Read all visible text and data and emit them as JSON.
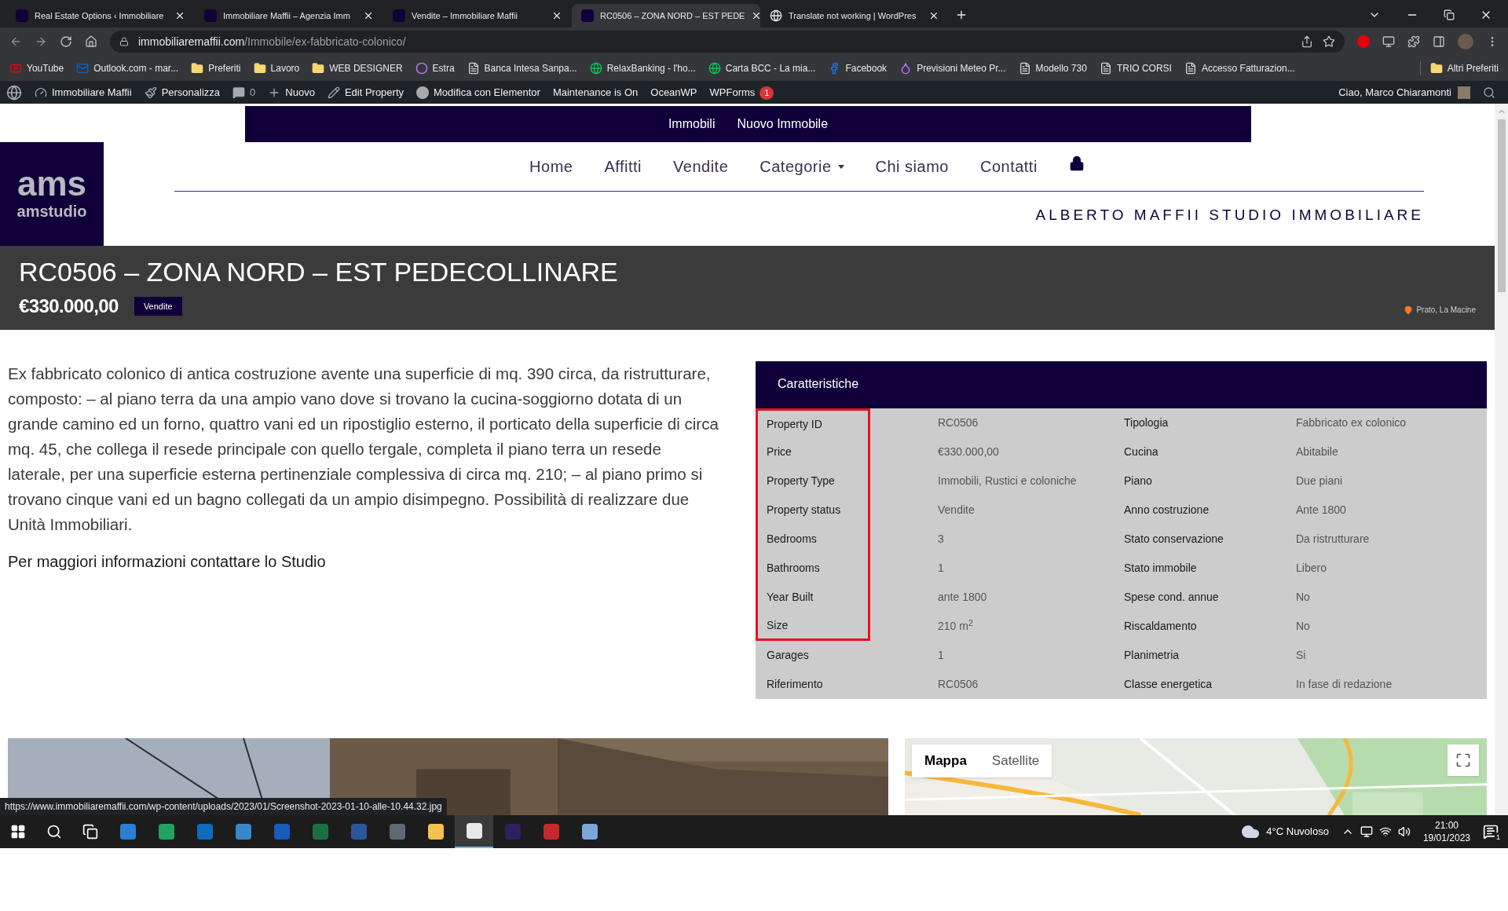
{
  "browser": {
    "tabs": [
      {
        "title": "Real Estate Options ‹ Immobiliare",
        "selected": false,
        "kind": "ams"
      },
      {
        "title": "Immobiliare Maffii – Agenzia Imm",
        "selected": false,
        "kind": "ams"
      },
      {
        "title": "Vendite – Immobiliare Maffii",
        "selected": false,
        "kind": "ams"
      },
      {
        "title": "RC0506 – ZONA NORD – EST PEDE",
        "selected": true,
        "kind": "ams"
      },
      {
        "title": "Translate not working | WordPres",
        "selected": false,
        "kind": "wp"
      }
    ],
    "url_host": "immobiliaremaffii.com",
    "url_path": "/Immobile/ex-fabbricato-colonico/",
    "bookmarks": [
      {
        "label": "YouTube",
        "kind": "youtube"
      },
      {
        "label": "Outlook.com - mar...",
        "kind": "outlook"
      },
      {
        "label": "Preferiti",
        "kind": "folder"
      },
      {
        "label": "Lavoro",
        "kind": "folder"
      },
      {
        "label": "WEB DESIGNER",
        "kind": "folder"
      },
      {
        "label": "Estra",
        "kind": "ring"
      },
      {
        "label": "Banca Intesa Sanpa...",
        "kind": "bank"
      },
      {
        "label": "RelaxBanking - l'ho...",
        "kind": "globe"
      },
      {
        "label": "Carta BCC - La mia...",
        "kind": "globe"
      },
      {
        "label": "Facebook",
        "kind": "facebook"
      },
      {
        "label": "Previsioni Meteo Pr...",
        "kind": "drop"
      },
      {
        "label": "Modello 730",
        "kind": "doc"
      },
      {
        "label": "TRIO CORSI",
        "kind": "trio"
      },
      {
        "label": "Accesso Fatturazion...",
        "kind": "doc"
      }
    ],
    "other_bookmarks": "Altri Preferiti"
  },
  "admin_bar": {
    "site": "Immobiliare Maffii",
    "customize": "Personalizza",
    "comments": "0",
    "new": "Nuovo",
    "edit": "Edit Property",
    "elementor": "Modifica con Elementor",
    "maintenance": "Maintenance is On",
    "theme": "OceanWP",
    "forms": "WPForms",
    "forms_badge": "1",
    "greeting": "Ciao, Marco Chiaramonti"
  },
  "top_menu": [
    "Immobili",
    "Nuovo Immobile"
  ],
  "logo": {
    "mark": "ams",
    "name": "amstudio"
  },
  "nav": [
    {
      "label": "Home",
      "dropdown": false
    },
    {
      "label": "Affitti",
      "dropdown": false
    },
    {
      "label": "Vendite",
      "dropdown": false
    },
    {
      "label": "Categorie",
      "dropdown": true
    },
    {
      "label": "Chi siamo",
      "dropdown": false
    },
    {
      "label": "Contatti",
      "dropdown": false
    }
  ],
  "tagline": "ALBERTO MAFFII STUDIO IMMOBILIARE",
  "property": {
    "title": "RC0506 – ZONA NORD – EST PEDECOLLINARE",
    "price": "€330.000,00",
    "status": "Vendite",
    "location": "Prato, La Macine"
  },
  "description": "Ex fabbricato colonico di antica costruzione avente una superficie di mq. 390 circa, da ristrutturare, composto: – al piano terra da una ampio vano dove si trovano la cucina-soggiorno dotata di un grande camino ed un forno, quattro vani ed un ripostiglio esterno, il porticato della superficie di circa mq. 45, che collega il resede principale con quello tergale, completa il piano terra un resede laterale, per una superficie esterna pertinenziale complessiva di circa mq. 210; – al piano primo si trovano cinque vani ed un bagno collegati da un ampio disimpegno. Possibilità di realizzare due Unità Immobiliari.",
  "contact_note": "Per maggiori informazioni contattare lo Studio",
  "features": {
    "tab": "Caratteristiche",
    "rows": [
      {
        "cells": [
          "Property ID",
          "RC0506",
          "Tipologia",
          "Fabbricato ex colonico"
        ],
        "highlighted": true
      },
      {
        "cells": [
          "Price",
          "€330.000,00",
          "Cucina",
          "Abitabile"
        ],
        "highlighted": true
      },
      {
        "cells": [
          "Property Type",
          "Immobili, Rustici e coloniche",
          "Piano",
          "Due piani"
        ],
        "highlighted": true
      },
      {
        "cells": [
          "Property status",
          "Vendite",
          "Anno costruzione",
          "Ante 1800"
        ],
        "highlighted": true
      },
      {
        "cells": [
          "Bedrooms",
          "3",
          "Stato conservazione",
          "Da ristrutturare"
        ],
        "highlighted": true
      },
      {
        "cells": [
          "Bathrooms",
          "1",
          "Stato immobile",
          "Libero"
        ],
        "highlighted": true
      },
      {
        "cells": [
          "Year Built",
          "ante 1800",
          "Spese cond. annue",
          "No"
        ],
        "highlighted": true
      },
      {
        "cells": [
          "Size",
          "210 m$^{2}$",
          "Riscaldamento",
          "No"
        ],
        "highlighted": true
      },
      {
        "cells": [
          "Garages",
          "1",
          "Planimetria",
          "Si"
        ],
        "highlighted": false
      },
      {
        "cells": [
          "Riferimento",
          "RC0506",
          "Classe energetica",
          "In fase di redazione"
        ],
        "highlighted": false
      }
    ]
  },
  "map": {
    "types": [
      {
        "label": "Mappa",
        "selected": true
      },
      {
        "label": "Satellite",
        "selected": false
      }
    ]
  },
  "status_url": "https://www.immobiliaremaffii.com/wp-content/uploads/2023/01/Screenshot-2023-01-10-alle-10.44.32.jpg",
  "taskbar": {
    "weather": "4°C Nuvoloso",
    "time": "21:00",
    "date": "19/01/2023",
    "notifications": "1"
  }
}
